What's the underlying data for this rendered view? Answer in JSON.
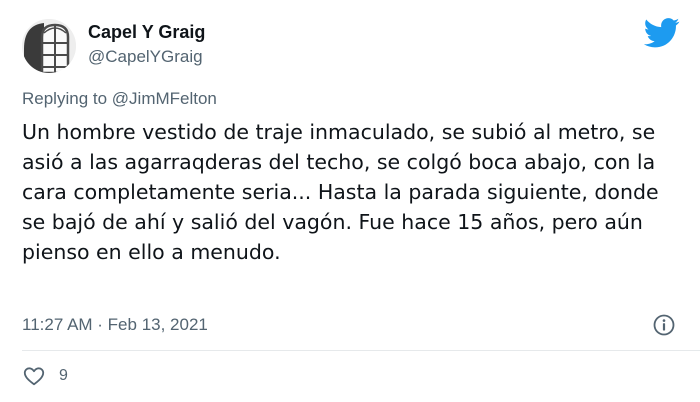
{
  "user": {
    "name": "Capel Y Graig",
    "handle": "@CapelYGraig"
  },
  "reply": {
    "prefix": "Replying to ",
    "mention": "@JimMFelton"
  },
  "tweet": {
    "text": "Un hombre vestido de traje inmaculado, se subió al metro, se asió a las agarraqderas del techo, se colgó boca abajo, con la cara completamente seria... Hasta la parada siguiente, donde se bajó de ahí y salió del vagón. Fue hace 15 años, pero aún pienso en ello a menudo.",
    "timestamp": "11:27 AM · Feb 13, 2021"
  },
  "actions": {
    "like_count": "9",
    "like_icon": "heart-icon",
    "info_icon": "info-icon"
  },
  "brand": {
    "icon": "twitter-bird-icon",
    "color": "#1d9bf0"
  },
  "colors": {
    "text": "#0f1419",
    "secondary": "#536471",
    "divider": "#e6e9eb"
  }
}
